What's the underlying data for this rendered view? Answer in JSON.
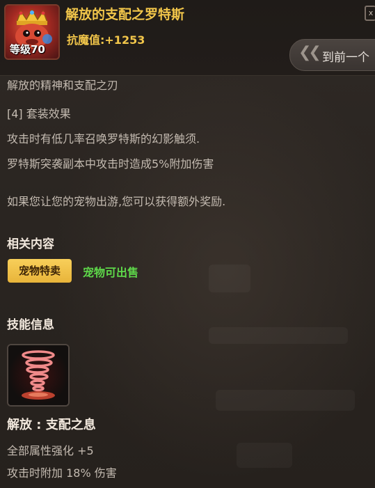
{
  "header": {
    "item_name": "解放的支配之罗特斯",
    "level_label": "等级70",
    "stat": "抗魔值:+1253",
    "close_label": "x",
    "prev_button_label": "到前一个",
    "avatar_icon": "crowned-creature-icon",
    "prev_icon": "double-chevron-left-icon"
  },
  "description": {
    "partial_line": "解放的精神和支配之刃",
    "set_effect_title": "[4] 套装效果",
    "lines": [
      "攻击时有低几率召唤罗特斯的幻影触须.",
      "罗特斯突袭副本中攻击时造成5%附加伤害"
    ],
    "pet_note": "如果您让您的宠物出游,您可以获得额外奖励."
  },
  "related": {
    "title": "相关内容",
    "tag_button": "宠物特卖",
    "tag_note": "宠物可出售"
  },
  "skill": {
    "title": "技能信息",
    "icon": "tornado-icon",
    "name": "解放 : 支配之息",
    "effects": [
      "全部属性强化 +5",
      "攻击时附加 18% 伤害"
    ]
  },
  "colors": {
    "gold": "#f2c64a",
    "green": "#5ed84a",
    "body_text": "#c4bbb1",
    "background": "#2a2420"
  }
}
